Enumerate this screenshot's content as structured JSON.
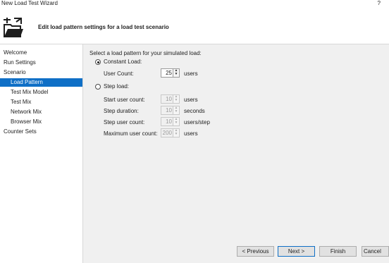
{
  "window": {
    "title": "New Load Test Wizard",
    "help_label": "?"
  },
  "header": {
    "title": "Edit load pattern settings for a load test scenario",
    "icon": "wizard-folder-icon"
  },
  "sidebar": {
    "items": [
      {
        "label": "Welcome"
      },
      {
        "label": "Run Settings"
      },
      {
        "label": "Scenario"
      },
      {
        "label": "Load Pattern",
        "selected": true
      },
      {
        "label": "Test Mix Model"
      },
      {
        "label": "Test Mix"
      },
      {
        "label": "Network Mix"
      },
      {
        "label": "Browser Mix"
      },
      {
        "label": "Counter Sets"
      }
    ],
    "selected_color": "#0f6fc6"
  },
  "content": {
    "prompt": "Select a load pattern for your simulated load:",
    "constant": {
      "label": "Constant Load:",
      "selected": true,
      "user_count_label": "User Count:",
      "user_count_value": "25",
      "user_count_unit": "users"
    },
    "step": {
      "label": "Step load:",
      "selected": false,
      "fields": [
        {
          "label": "Start user count:",
          "value": "10",
          "unit": "users"
        },
        {
          "label": "Step duration:",
          "value": "10",
          "unit": "seconds"
        },
        {
          "label": "Step user count:",
          "value": "10",
          "unit": "users/step"
        },
        {
          "label": "Maximum user count:",
          "value": "200",
          "unit": "users"
        }
      ]
    }
  },
  "buttons": {
    "previous": "< Previous",
    "next": "Next >",
    "finish": "Finish",
    "cancel": "Cancel"
  }
}
